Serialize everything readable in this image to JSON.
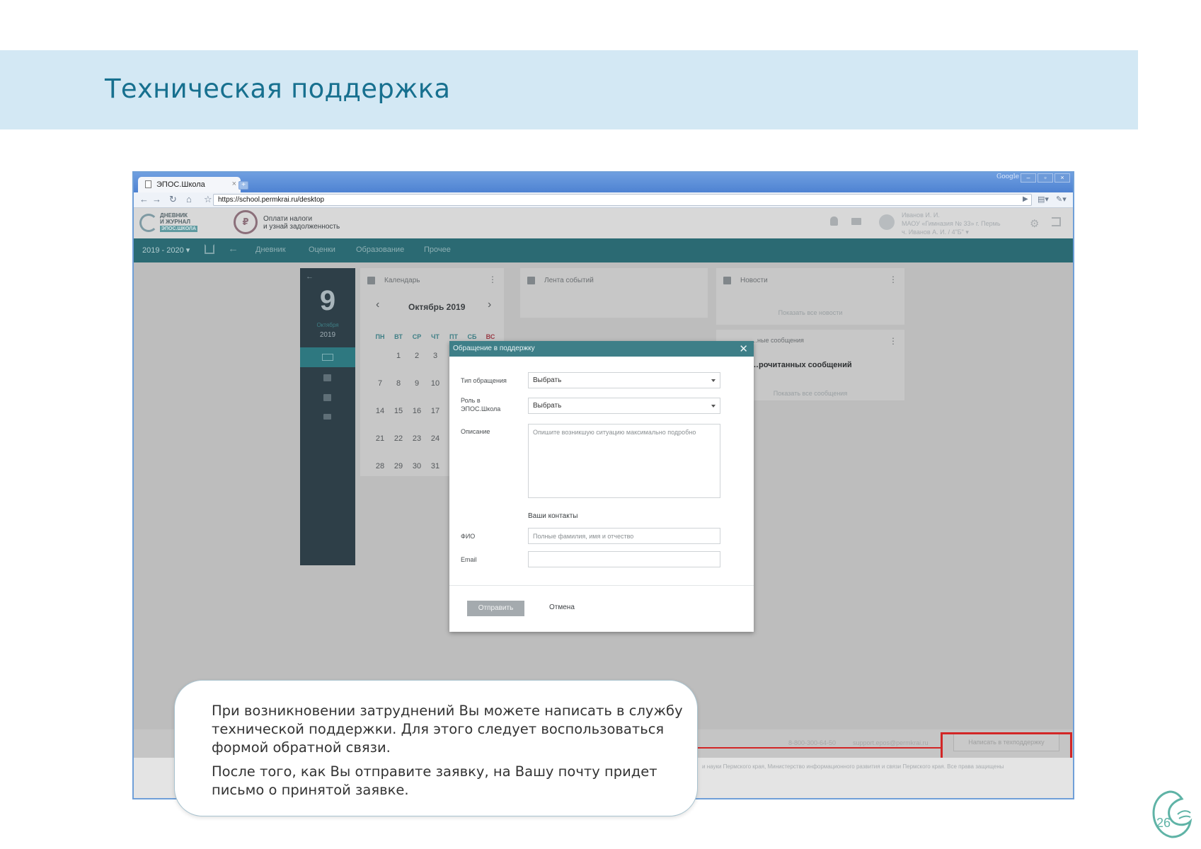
{
  "slide": {
    "title": "Техническая поддержка"
  },
  "browser": {
    "tab_title": "ЭПОС.Школа",
    "tab_close": "×",
    "new_tab": "+",
    "brand": "Google",
    "window_buttons": [
      "–",
      "▫",
      "×"
    ],
    "url": "https://school.permkrai.ru/desktop"
  },
  "app": {
    "logo_line1": "ДНЕВНИК",
    "logo_line2": "И ЖУРНАЛ",
    "logo_sub": "ЭПОС.ШКОЛА",
    "tax_line1": "Оплати налоги",
    "tax_line2": "и узнай задолженность",
    "user_line1": "Иванов И. И.",
    "user_line2": "МАОУ «Гимназия № 33» г. Пермь",
    "user_line3": "ч. Иванов А. И. / 4\"Б\" ▾",
    "nav": {
      "year": "2019 - 2020 ▾",
      "items": [
        "Дневник",
        "Оценки",
        "Образование",
        "Прочее"
      ]
    }
  },
  "date_panel": {
    "day": "9",
    "month": "Октября",
    "year": "2019"
  },
  "calendar": {
    "title": "Календарь",
    "month": "Октябрь 2019",
    "weekdays": [
      "ПН",
      "ВТ",
      "СР",
      "ЧТ",
      "ПТ",
      "СБ",
      "ВС"
    ],
    "weeks": [
      [
        "",
        "1",
        "2",
        "3"
      ],
      [
        "7",
        "8",
        "9",
        "10"
      ],
      [
        "14",
        "15",
        "16",
        "17"
      ],
      [
        "21",
        "22",
        "23",
        "24"
      ],
      [
        "28",
        "29",
        "30",
        "31"
      ]
    ]
  },
  "events": {
    "title": "Лента событий"
  },
  "news": {
    "title": "Новости",
    "link": "Показать все новости"
  },
  "messages": {
    "title": "…ные сообщения",
    "text": "…рочитанных сообщений",
    "link": "Показать все сообщения"
  },
  "modal": {
    "title": "Обращение в поддержку",
    "close": "✕",
    "type_label": "Тип обращения",
    "type_value": "Выбрать",
    "role_label_1": "Роль в",
    "role_label_2": "ЭПОС.Школа",
    "role_value": "Выбрать",
    "desc_label": "Описание",
    "desc_placeholder": "Опишите возникшую ситуацию максимально подробно",
    "contacts_title": "Ваши контакты",
    "fio_label": "ФИО",
    "fio_placeholder": "Полные фамилия, имя и отчество",
    "email_label": "Email",
    "email_value": "",
    "send": "Отправить",
    "cancel": "Отмена"
  },
  "footer": {
    "phone": "8-800-300-64-50",
    "email": "support.epos@permkrai.ru",
    "support_button": "Написать в техподдержку",
    "copyright": "и науки Пермского края, Министерство информационного развития и связи Пермского края. Все права защищены"
  },
  "callout": {
    "p1": "При возникновении затруднений Вы можете написать в службу технической поддержки. Для этого следует воспользоваться формой обратной связи.",
    "p2": "После того, как Вы отправите заявку, на Вашу почту придет письмо о принятой заявке."
  },
  "corner_logo_text": "26",
  "colors": {
    "header_band": "#d3e8f4",
    "title": "#17708f",
    "app_nav": "#2b6a73",
    "highlight": "#d22626"
  }
}
